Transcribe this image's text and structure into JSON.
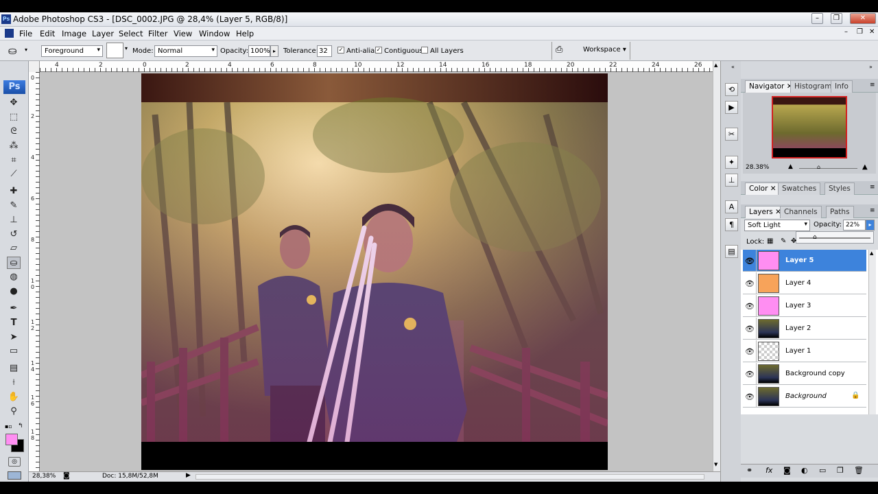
{
  "window": {
    "app_icon": "Ps",
    "title": "Adobe Photoshop CS3 - [DSC_0002.JPG @ 28,4% (Layer 5, RGB/8)]",
    "controls": [
      "–",
      "❐",
      "✕"
    ],
    "doc_controls": [
      "–",
      "❐",
      "✕"
    ]
  },
  "menu": [
    "File",
    "Edit",
    "Image",
    "Layer",
    "Select",
    "Filter",
    "View",
    "Window",
    "Help"
  ],
  "options": {
    "fill_source": "Foreground",
    "mode_label": "Mode:",
    "mode_value": "Normal",
    "opacity_label": "Opacity:",
    "opacity_value": "100%",
    "tolerance_label": "Tolerance:",
    "tolerance_value": "32",
    "antialias_label": "Anti-alias",
    "contiguous_label": "Contiguous",
    "all_layers_label": "All Layers",
    "workspace_label": "Workspace ▾"
  },
  "toolbox": {
    "logo": "Ps",
    "tools": [
      "move-icon",
      "marquee-icon",
      "lasso-icon",
      "magic-wand-icon",
      "crop-icon",
      "slice-icon",
      "healing-icon",
      "brush-icon",
      "stamp-icon",
      "history-brush-icon",
      "eraser-icon",
      "paint-bucket-icon",
      "blur-icon",
      "dodge-icon",
      "pen-icon",
      "type-icon",
      "path-select-icon",
      "shape-icon",
      "notes-icon",
      "eyedropper-icon",
      "hand-icon",
      "zoom-icon"
    ],
    "foreground_color": "#ff8ef2",
    "background_color": "#000000"
  },
  "rulers": {
    "top": [
      "4",
      "2",
      "0",
      "2",
      "4",
      "6",
      "8",
      "10",
      "12",
      "14",
      "16",
      "18",
      "20",
      "22",
      "24",
      "26"
    ],
    "left": [
      "0",
      "2",
      "4",
      "6",
      "8",
      "1 0",
      "1 2",
      "1 4",
      "1 6",
      "1 8",
      "2 0",
      "2 2"
    ]
  },
  "status": {
    "zoom": "28,38%",
    "doc": "Doc: 15,8M/52,8M"
  },
  "navigator": {
    "tabs": [
      "Navigator",
      "Histogram",
      "Info"
    ],
    "zoom": "28.38%"
  },
  "color_panel": {
    "tabs": [
      "Color",
      "Swatches",
      "Styles"
    ]
  },
  "layers_panel": {
    "tabs": [
      "Layers",
      "Channels",
      "Paths"
    ],
    "blend_mode": "Soft Light",
    "opacity_label": "Opacity:",
    "opacity_value": "22%",
    "lock_label": "Lock:",
    "opacity_slider_fraction": 0.22,
    "layers": [
      {
        "name": "Layer 5",
        "thumb": "#ff8ef2",
        "selected": true
      },
      {
        "name": "Layer 4",
        "thumb": "#f7a35a",
        "selected": false
      },
      {
        "name": "Layer 3",
        "thumb": "#ff8ef2",
        "selected": false
      },
      {
        "name": "Layer 2",
        "thumb": "photo",
        "selected": false
      },
      {
        "name": "Layer 1",
        "thumb": "checker",
        "selected": false
      },
      {
        "name": "Background copy",
        "thumb": "photo",
        "selected": false
      },
      {
        "name": "Background",
        "thumb": "photo",
        "selected": false,
        "italic": true,
        "locked": true
      }
    ],
    "footer_icons": [
      "link-icon",
      "fx-icon",
      "mask-icon",
      "adjustment-icon",
      "group-icon",
      "new-layer-icon",
      "trash-icon"
    ]
  }
}
